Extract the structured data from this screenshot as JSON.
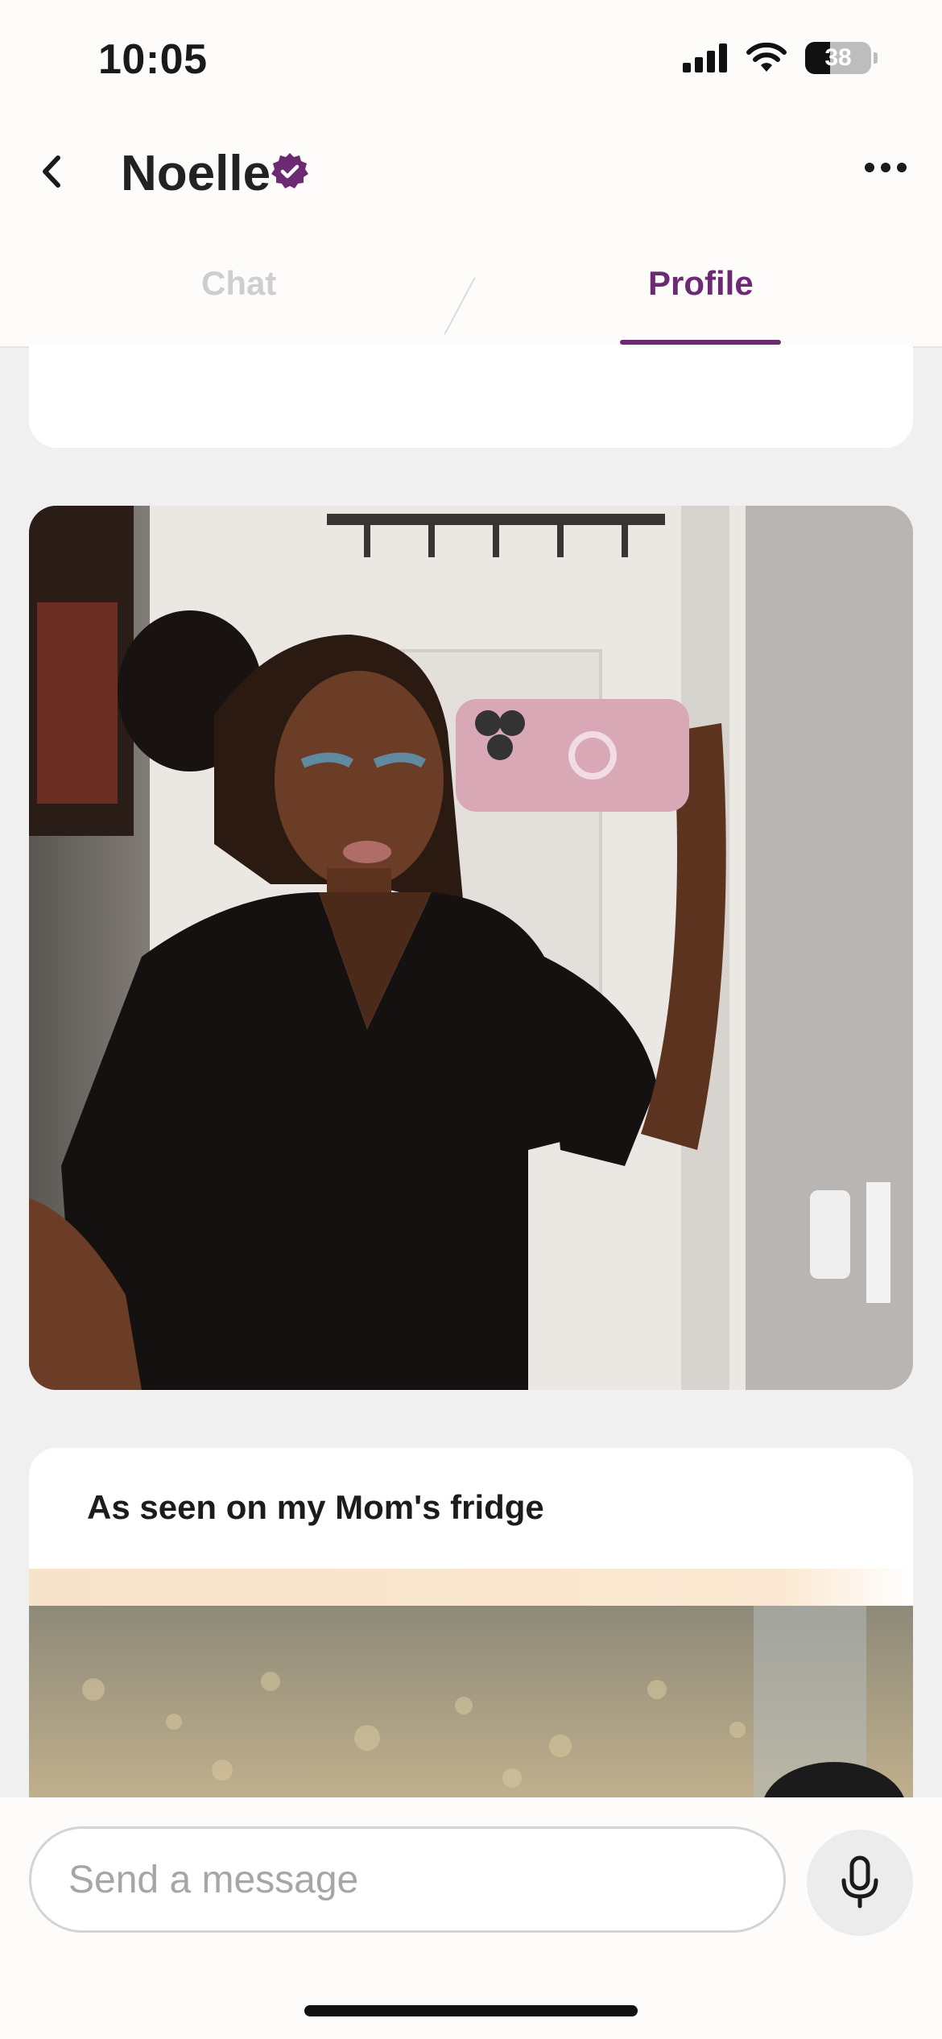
{
  "status_bar": {
    "time": "10:05",
    "battery_level": "38"
  },
  "header": {
    "name": "Noelle",
    "verified": true
  },
  "tabs": [
    {
      "label": "Chat",
      "active": false
    },
    {
      "label": "Profile",
      "active": true
    }
  ],
  "profile": {
    "prompt": {
      "question": "As seen on my Mom's fridge"
    }
  },
  "composer": {
    "placeholder": "Send a message"
  },
  "colors": {
    "accent": "#6b2a72",
    "background": "#f0f0f0",
    "card": "#ffffff"
  },
  "icons": {
    "back": "chevron-left-icon",
    "verified": "verified-badge-icon",
    "more": "more-horizontal-icon",
    "mic": "microphone-icon"
  }
}
